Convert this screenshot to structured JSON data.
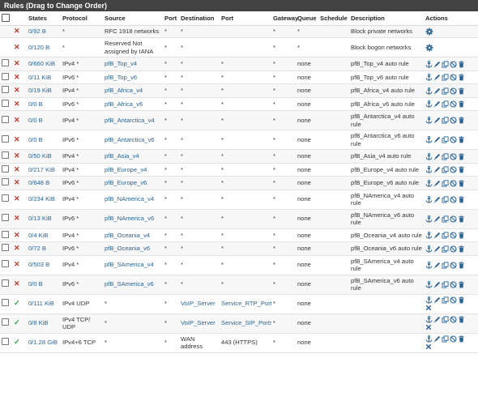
{
  "panel": {
    "title": "Rules (Drag to Change Order)"
  },
  "columns": [
    "States",
    "Protocol",
    "Source",
    "Port",
    "Destination",
    "Port",
    "Gateway",
    "Queue",
    "Schedule",
    "Description",
    "Actions"
  ],
  "rows": [
    {
      "has_checkbox": false,
      "status": "x",
      "states": "0/92 B",
      "protocol": "*",
      "source": "RFC 1918 networks",
      "source_link": false,
      "sport": "*",
      "dest": "*",
      "dest_link": false,
      "dport": "",
      "dport_link": false,
      "gateway": "*",
      "queue": "*",
      "schedule": "",
      "desc": "Block private networks",
      "actions": "gear"
    },
    {
      "has_checkbox": false,
      "status": "x",
      "states": "0/120 B",
      "protocol": "*",
      "source": "Reserved Not assigned by IANA",
      "source_link": false,
      "sport": "*",
      "dest": "*",
      "dest_link": false,
      "dport": "",
      "dport_link": false,
      "gateway": "*",
      "queue": "*",
      "schedule": "",
      "desc": "Block bogon networks",
      "actions": "gear"
    },
    {
      "has_checkbox": true,
      "status": "x",
      "states": "0/660 KiB",
      "protocol": "IPv4 *",
      "source": "pfB_Top_v4",
      "source_link": true,
      "sport": "*",
      "dest": "*",
      "dest_link": false,
      "dport": "*",
      "dport_link": false,
      "gateway": "*",
      "queue": "none",
      "schedule": "",
      "desc": "pfB_Top_v4 auto rule",
      "actions": "full"
    },
    {
      "has_checkbox": true,
      "status": "x",
      "states": "0/11 KiB",
      "protocol": "IPv6 *",
      "source": "pfB_Top_v6",
      "source_link": true,
      "sport": "*",
      "dest": "*",
      "dest_link": false,
      "dport": "*",
      "dport_link": false,
      "gateway": "*",
      "queue": "none",
      "schedule": "",
      "desc": "pfB_Top_v6 auto rule",
      "actions": "full"
    },
    {
      "has_checkbox": true,
      "status": "x",
      "states": "0/19 KiB",
      "protocol": "IPv4 *",
      "source": "pfB_Africa_v4",
      "source_link": true,
      "sport": "*",
      "dest": "*",
      "dest_link": false,
      "dport": "*",
      "dport_link": false,
      "gateway": "*",
      "queue": "none",
      "schedule": "",
      "desc": "pfB_Africa_v4 auto rule",
      "actions": "full"
    },
    {
      "has_checkbox": true,
      "status": "x",
      "states": "0/0 B",
      "protocol": "IPv6 *",
      "source": "pfB_Africa_v6",
      "source_link": true,
      "sport": "*",
      "dest": "*",
      "dest_link": false,
      "dport": "*",
      "dport_link": false,
      "gateway": "*",
      "queue": "none",
      "schedule": "",
      "desc": "pfB_Africa_v6 auto rule",
      "actions": "full"
    },
    {
      "has_checkbox": true,
      "status": "x",
      "states": "0/0 B",
      "protocol": "IPv4 *",
      "source": "pfB_Antarctica_v4",
      "source_link": true,
      "sport": "*",
      "dest": "*",
      "dest_link": false,
      "dport": "*",
      "dport_link": false,
      "gateway": "*",
      "queue": "none",
      "schedule": "",
      "desc": "pfB_Antarctica_v4 auto rule",
      "actions": "full"
    },
    {
      "has_checkbox": true,
      "status": "x",
      "states": "0/0 B",
      "protocol": "IPv6 *",
      "source": "pfB_Antarctica_v6",
      "source_link": true,
      "sport": "*",
      "dest": "*",
      "dest_link": false,
      "dport": "*",
      "dport_link": false,
      "gateway": "*",
      "queue": "none",
      "schedule": "",
      "desc": "pfB_Antarctica_v6 auto rule",
      "actions": "full"
    },
    {
      "has_checkbox": true,
      "status": "x",
      "states": "0/50 KiB",
      "protocol": "IPv4 *",
      "source": "pfB_Asia_v4",
      "source_link": true,
      "sport": "*",
      "dest": "*",
      "dest_link": false,
      "dport": "*",
      "dport_link": false,
      "gateway": "*",
      "queue": "none",
      "schedule": "",
      "desc": "pfB_Asia_v4 auto rule",
      "actions": "full"
    },
    {
      "has_checkbox": true,
      "status": "x",
      "states": "0/217 KiB",
      "protocol": "IPv4 *",
      "source": "pfB_Europe_v4",
      "source_link": true,
      "sport": "*",
      "dest": "*",
      "dest_link": false,
      "dport": "*",
      "dport_link": false,
      "gateway": "*",
      "queue": "none",
      "schedule": "",
      "desc": "pfB_Europe_v4 auto rule",
      "actions": "full"
    },
    {
      "has_checkbox": true,
      "status": "x",
      "states": "0/648 B",
      "protocol": "IPv6 *",
      "source": "pfB_Europe_v6",
      "source_link": true,
      "sport": "*",
      "dest": "*",
      "dest_link": false,
      "dport": "*",
      "dport_link": false,
      "gateway": "*",
      "queue": "none",
      "schedule": "",
      "desc": "pfB_Europe_v6 auto rule",
      "actions": "full"
    },
    {
      "has_checkbox": true,
      "status": "x",
      "states": "0/234 KiB",
      "protocol": "IPv4 *",
      "source": "pfB_NAmerica_v4",
      "source_link": true,
      "sport": "*",
      "dest": "*",
      "dest_link": false,
      "dport": "*",
      "dport_link": false,
      "gateway": "*",
      "queue": "none",
      "schedule": "",
      "desc": "pfB_NAmerica_v4 auto rule",
      "actions": "full"
    },
    {
      "has_checkbox": true,
      "status": "x",
      "states": "0/13 KiB",
      "protocol": "IPv6 *",
      "source": "pfB_NAmerica_v6",
      "source_link": true,
      "sport": "*",
      "dest": "*",
      "dest_link": false,
      "dport": "*",
      "dport_link": false,
      "gateway": "*",
      "queue": "none",
      "schedule": "",
      "desc": "pfB_NAmerica_v6 auto rule",
      "actions": "full"
    },
    {
      "has_checkbox": true,
      "status": "x",
      "states": "0/4 KiB",
      "protocol": "IPv4 *",
      "source": "pfB_Oceania_v4",
      "source_link": true,
      "sport": "*",
      "dest": "*",
      "dest_link": false,
      "dport": "*",
      "dport_link": false,
      "gateway": "*",
      "queue": "none",
      "schedule": "",
      "desc": "pfB_Oceania_v4 auto rule",
      "actions": "full"
    },
    {
      "has_checkbox": true,
      "status": "x",
      "states": "0/72 B",
      "protocol": "IPv6 *",
      "source": "pfB_Oceania_v6",
      "source_link": true,
      "sport": "*",
      "dest": "*",
      "dest_link": false,
      "dport": "*",
      "dport_link": false,
      "gateway": "*",
      "queue": "none",
      "schedule": "",
      "desc": "pfB_Oceania_v6 auto rule",
      "actions": "full"
    },
    {
      "has_checkbox": true,
      "status": "x",
      "states": "0/503 B",
      "protocol": "IPv4 *",
      "source": "pfB_SAmerica_v4",
      "source_link": true,
      "sport": "*",
      "dest": "*",
      "dest_link": false,
      "dport": "*",
      "dport_link": false,
      "gateway": "*",
      "queue": "none",
      "schedule": "",
      "desc": "pfB_SAmerica_v4 auto rule",
      "actions": "full"
    },
    {
      "has_checkbox": true,
      "status": "x",
      "states": "0/0 B",
      "protocol": "IPv6 *",
      "source": "pfB_SAmerica_v6",
      "source_link": true,
      "sport": "*",
      "dest": "*",
      "dest_link": false,
      "dport": "*",
      "dport_link": false,
      "gateway": "*",
      "queue": "none",
      "schedule": "",
      "desc": "pfB_SAmerica_v6 auto rule",
      "actions": "full"
    },
    {
      "has_checkbox": true,
      "status": "check",
      "states": "0/111 KiB",
      "protocol": "IPv4 UDP",
      "source": "*",
      "source_link": false,
      "sport": "*",
      "dest": "VoIP_Server",
      "dest_link": true,
      "dport": "Service_RTP_Ports",
      "dport_link": true,
      "gateway": "*",
      "queue": "none",
      "schedule": "",
      "desc": "",
      "actions": "full2"
    },
    {
      "has_checkbox": true,
      "status": "check",
      "states": "0/8 KiB",
      "protocol": "IPv4 TCP/ UDP",
      "source": "*",
      "source_link": false,
      "sport": "*",
      "dest": "VoIP_Server",
      "dest_link": true,
      "dport": "Service_SIP_Ports",
      "dport_link": true,
      "gateway": "*",
      "queue": "none",
      "schedule": "",
      "desc": "",
      "actions": "full2"
    },
    {
      "has_checkbox": true,
      "status": "check",
      "states": "0/1.28 GiB",
      "protocol": "IPv4+6 TCP",
      "source": "*",
      "source_link": false,
      "sport": "*",
      "dest": "WAN address",
      "dest_link": false,
      "dport": "443 (HTTPS)",
      "dport_link": false,
      "gateway": "*",
      "queue": "none",
      "schedule": "",
      "desc": "",
      "actions": "full2"
    }
  ],
  "colors": {
    "header_bg": "#424242",
    "link": "#2a6496",
    "block": "#c0392b",
    "pass": "#2e9b46"
  },
  "icons": [
    "anchor-icon",
    "pencil-icon",
    "copy-icon",
    "disable-icon",
    "trash-icon",
    "gear-icon",
    "x-icon",
    "check-icon"
  ]
}
